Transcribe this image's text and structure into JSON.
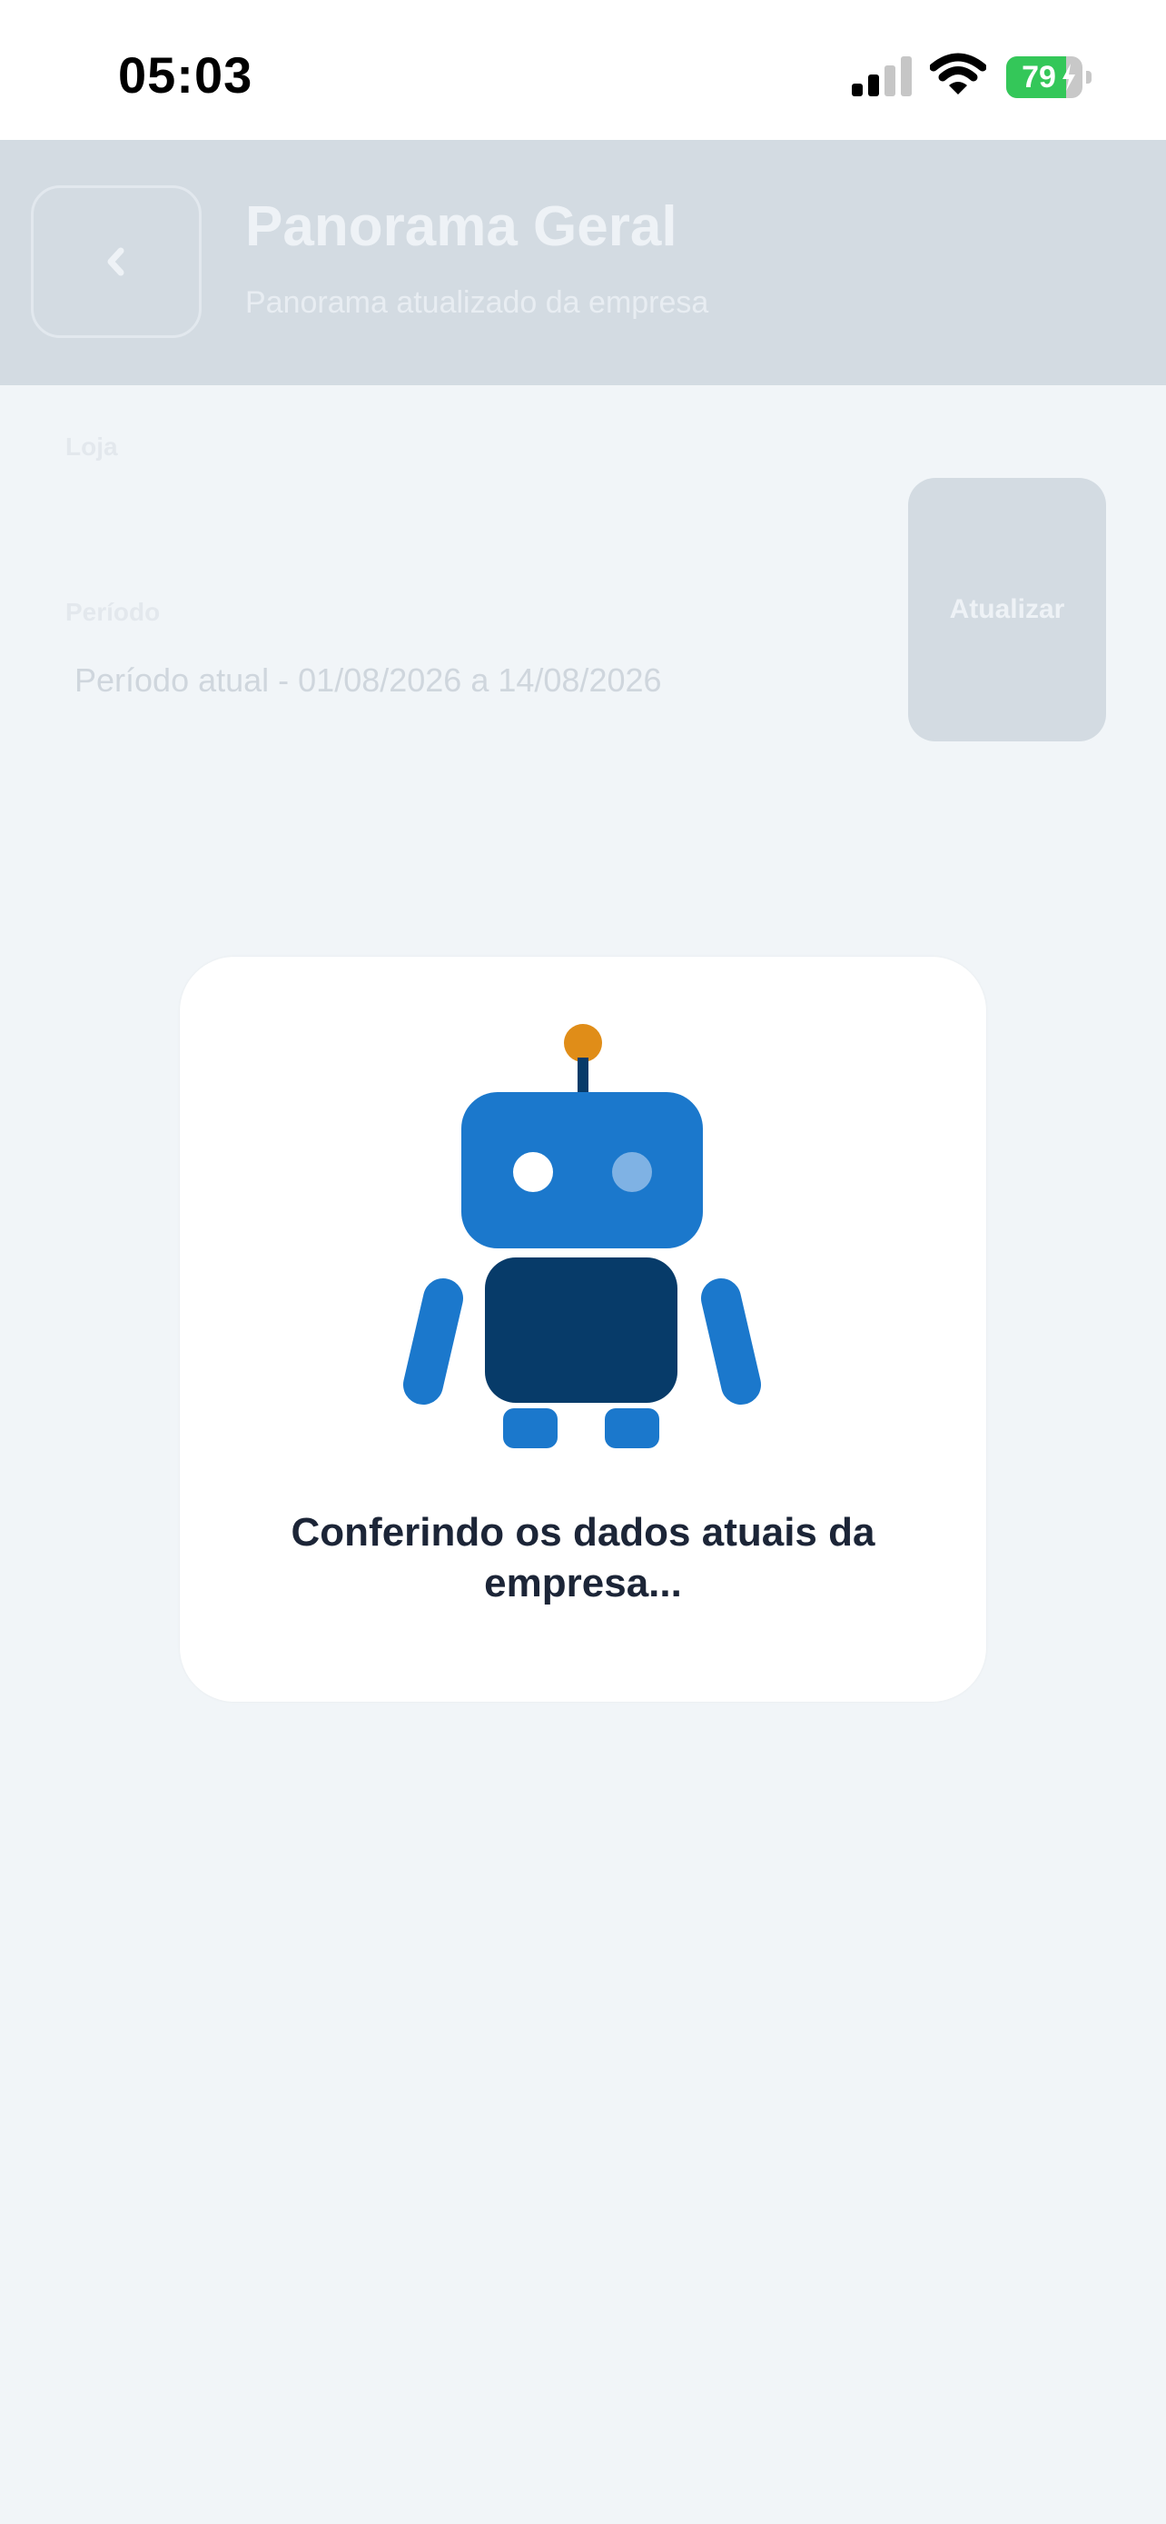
{
  "status_bar": {
    "time": "05:03",
    "battery_percent": "79",
    "battery_level": 0.79,
    "icons": [
      "cellular-signal-icon",
      "wifi-icon",
      "battery-charging-icon"
    ]
  },
  "header": {
    "back_icon": "chevron-left-icon",
    "title": "Panorama Geral",
    "subtitle": "Panorama atualizado da empresa"
  },
  "filters": {
    "store_label": "Loja",
    "store_value": "",
    "period_label": "Período",
    "period_value": "Período atual - 01/08/2026 a 14/08/2026",
    "update_button": "Atualizar"
  },
  "loading": {
    "icon": "robot-icon",
    "message": "Conferindo os dados atuais da empresa..."
  },
  "colors": {
    "background": "#f1f5f8",
    "header": "#d3dbe2",
    "robot_primary": "#1b78cc",
    "robot_dark": "#073b69",
    "robot_antenna": "#e08d18",
    "text_dark": "#1c2537",
    "battery_green": "#34c759"
  }
}
